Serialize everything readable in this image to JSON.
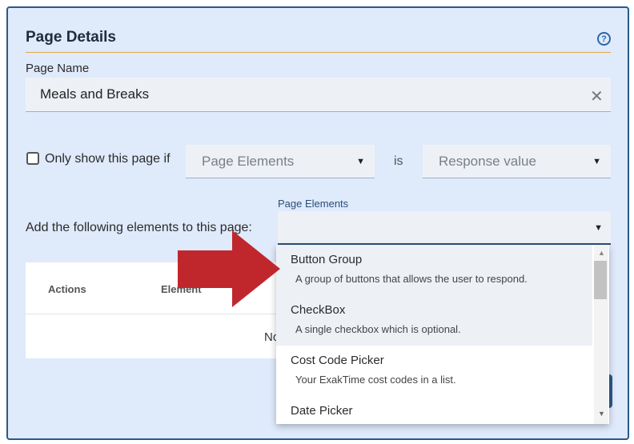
{
  "card": {
    "title": "Page Details",
    "help_icon": "question-circle-icon",
    "help_glyph": "?"
  },
  "page_name": {
    "label": "Page Name",
    "value": "Meals and Breaks",
    "clear_icon": "close-icon",
    "clear_glyph": "✕"
  },
  "condition": {
    "checkbox_label": "Only show this page if",
    "checked": false,
    "element_select": "Page Elements",
    "operator": "is",
    "value_select": "Response value"
  },
  "add_elements": {
    "label": "Add the following elements to this page:",
    "select_caption": "Page Elements",
    "select_value": ""
  },
  "table": {
    "columns": [
      "Actions",
      "Element"
    ],
    "empty_text": "No"
  },
  "dropdown": {
    "options": [
      {
        "name": "Button Group",
        "description": "A group of buttons that allows the user to respond.",
        "highlighted": true
      },
      {
        "name": "CheckBox",
        "description": "A single checkbox which is optional.",
        "highlighted": true
      },
      {
        "name": "Cost Code Picker",
        "description": "Your ExakTime cost codes in a list.",
        "highlighted": false
      },
      {
        "name": "Date Picker",
        "description": "",
        "highlighted": false
      }
    ],
    "scroll_up_glyph": "▲",
    "scroll_down_glyph": "▼"
  },
  "glyphs": {
    "caret": "▼"
  },
  "colors": {
    "panel_bg": "#dfeafb",
    "panel_border": "#2a5a86",
    "accent_rule": "#e0a94a",
    "annotation_arrow": "#c0272d"
  }
}
